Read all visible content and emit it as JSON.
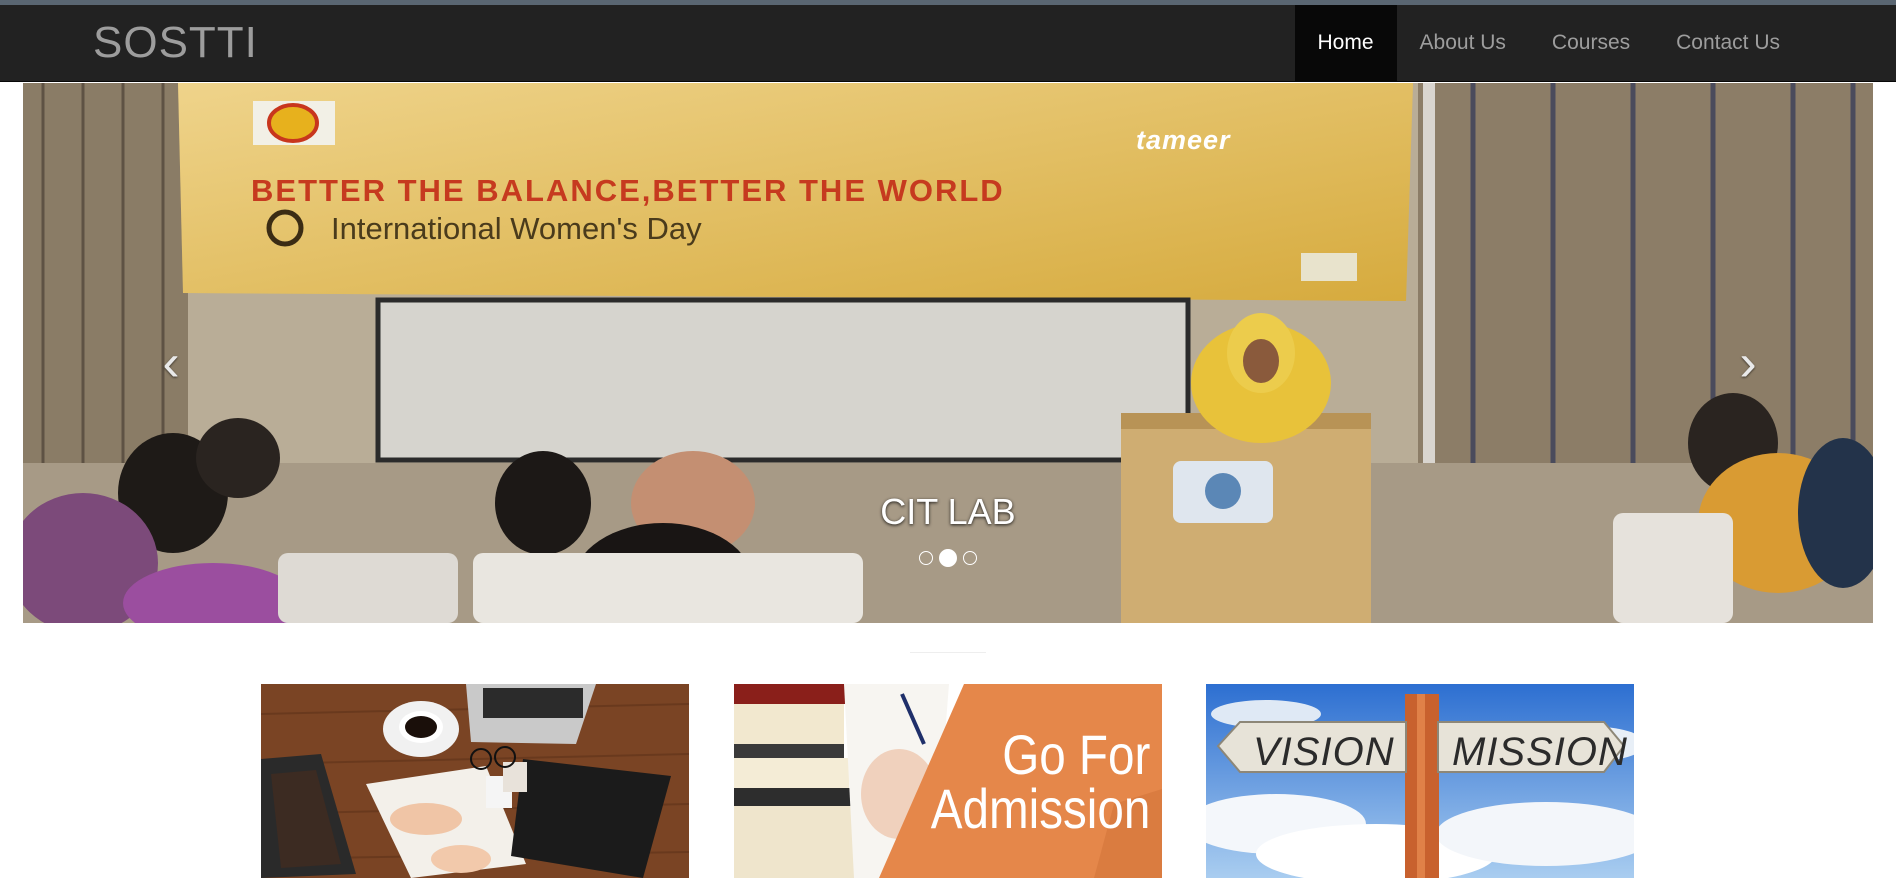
{
  "nav": {
    "brand": "SOSTTI",
    "items": [
      {
        "label": "Home",
        "active": true
      },
      {
        "label": "About Us",
        "active": false
      },
      {
        "label": "Courses",
        "active": false
      },
      {
        "label": "Contact Us",
        "active": false
      }
    ]
  },
  "carousel": {
    "banner": {
      "line1": "BETTER THE BALANCE,BETTER THE WORLD",
      "line2": "International Women's Day",
      "logo": "tameer"
    },
    "caption": "CIT LAB",
    "prev_icon": "chevron-left-icon",
    "next_icon": "chevron-right-icon",
    "slide_count": 3,
    "active_slide": 2
  },
  "tiles": [
    {
      "name": "study-desk-image"
    },
    {
      "name": "go-for-admission-image",
      "text_line1": "Go For",
      "text_line2": "Admission"
    },
    {
      "name": "vision-mission-image",
      "left_sign": "VISION",
      "right_sign": "MISSION"
    }
  ],
  "colors": {
    "navbar": "#222222",
    "nav_active": "#080808",
    "nav_text": "#9d9d9d",
    "banner_yellow": "#e6bc4c",
    "admission_orange": "#e5874a"
  }
}
